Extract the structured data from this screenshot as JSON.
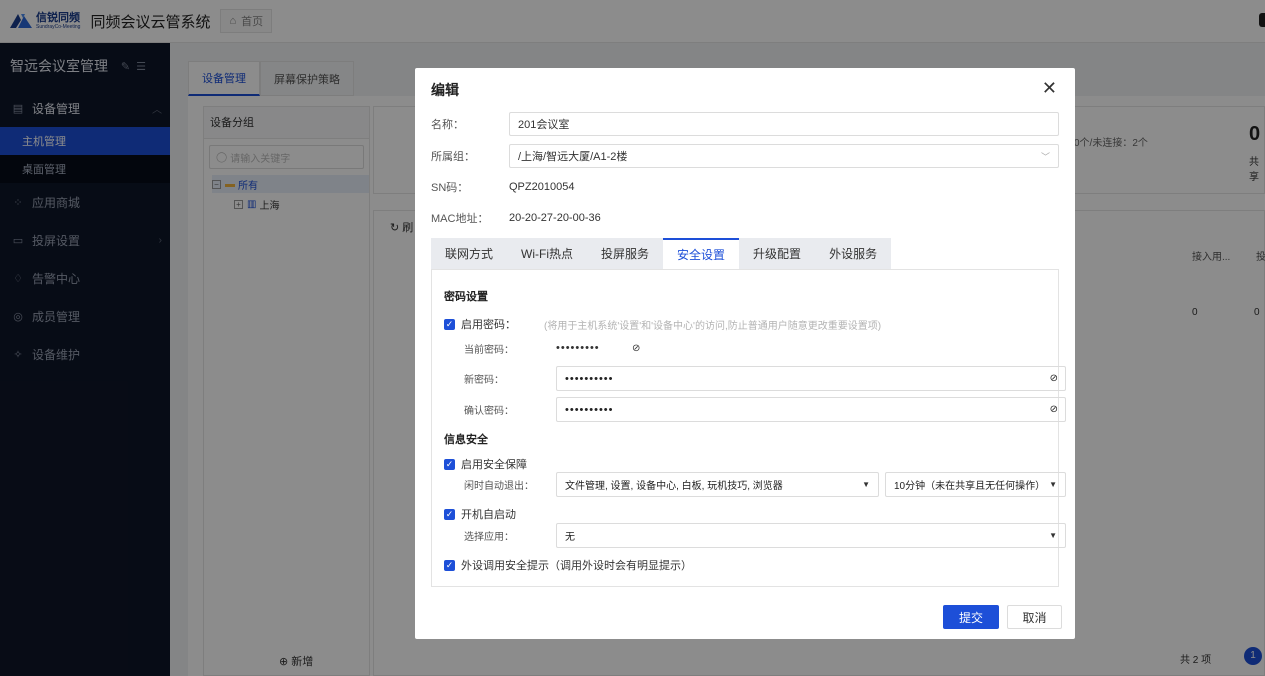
{
  "header": {
    "logo_cn": "信锐同频",
    "logo_en": "SundrayCo-Meeting",
    "app_title": "同频会议云管系统",
    "home_tab": "首页"
  },
  "sidebar": {
    "title": "智远会议室管理",
    "items": [
      {
        "label": "设备管理",
        "icon": "server-icon"
      },
      {
        "label": "应用商城",
        "icon": "grid-icon"
      },
      {
        "label": "投屏设置",
        "icon": "monitor-icon"
      },
      {
        "label": "告警中心",
        "icon": "bell-icon"
      },
      {
        "label": "成员管理",
        "icon": "user-icon"
      },
      {
        "label": "设备维护",
        "icon": "wrench-icon"
      }
    ],
    "subitems": [
      {
        "label": "主机管理",
        "active": true
      },
      {
        "label": "桌面管理",
        "active": false
      }
    ]
  },
  "main": {
    "tabs": [
      {
        "label": "设备管理"
      },
      {
        "label": "屏幕保护策略"
      }
    ],
    "group_panel": {
      "title": "设备分组",
      "search_placeholder": "请输入关键字",
      "tree": [
        "所有",
        "上海"
      ],
      "add_label": "新增"
    },
    "stats": {
      "summary": "：0个/未连接：2个",
      "big_digit": "0",
      "share_label": "共享"
    },
    "table": {
      "refresh_label": "刷",
      "col_access": "接入用...",
      "col_more": "投",
      "row_value_1": "0",
      "row_value_2": "0",
      "footer_total": "共 2 项",
      "page": "1"
    }
  },
  "modal": {
    "title": "编辑",
    "fields": {
      "name_label": "名称：",
      "name_value": "201会议室",
      "group_label": "所属组：",
      "group_value": "/上海/智远大厦/A1-2楼",
      "sn_label": "SN码：",
      "sn_value": "QPZ2010054",
      "mac_label": "MAC地址：",
      "mac_value": "20-20-27-20-00-36"
    },
    "subtabs": [
      "联网方式",
      "Wi-Fi热点",
      "投屏服务",
      "安全设置",
      "升级配置",
      "外设服务"
    ],
    "active_subtab": "安全设置",
    "password": {
      "section": "密码设置",
      "enable_label": "启用密码：",
      "hint": "(将用于主机系统'设置'和'设备中心'的访问,防止普通用户随意更改重要设置项)",
      "current_label": "当前密码：",
      "current_value": "•••••••••",
      "new_label": "新密码：",
      "new_value": "••••••••••",
      "confirm_label": "确认密码：",
      "confirm_value": "••••••••••"
    },
    "security": {
      "section": "信息安全",
      "enable_label": "启用安全保障",
      "idle_label": "闲时自动退出：",
      "idle_apps": "文件管理, 设置, 设备中心, 白板, 玩机技巧, 浏览器",
      "idle_time": "10分钟（未在共享且无任何操作）",
      "autostart_label": "开机自启动",
      "choose_app_label": "选择应用：",
      "choose_app_value": "无",
      "peripheral_label": "外设调用安全提示（调用外设时会有明显提示）"
    },
    "buttons": {
      "submit": "提交",
      "cancel": "取消"
    }
  },
  "colors": {
    "primary": "#1d4fd8",
    "sidebar_bg": "#0e1628"
  }
}
